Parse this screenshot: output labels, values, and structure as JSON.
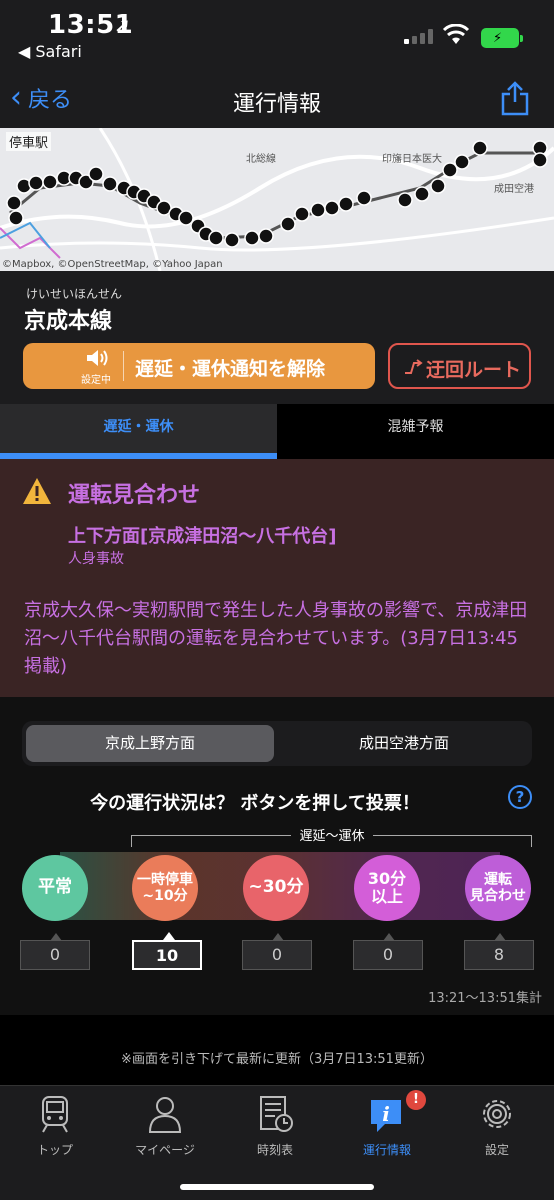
{
  "status_bar": {
    "time": "13:51",
    "back_app": "◀ Safari"
  },
  "nav": {
    "back_label": "戻る",
    "title": "運行情報"
  },
  "map": {
    "stop_label": "停車駅",
    "credit": "©Mapbox, ©OpenStreetMap, ©Yahoo Japan",
    "places": [
      "北総線",
      "印旛日本医大",
      "成田空港"
    ]
  },
  "line": {
    "reading": "けいせいほんせん",
    "name": "京成本線"
  },
  "actions": {
    "setting_status": "設定中",
    "notify_label": "遅延・運休通知を解除",
    "detour_label": "迂回ルート"
  },
  "tabs": {
    "delay": "遅延・運休",
    "congestion": "混雑予報"
  },
  "alert": {
    "headline": "運転見合わせ",
    "section": "上下方面[京成津田沼〜八千代台]",
    "cause": "人身事故",
    "body": "京成大久保〜実籾駅間で発生した人身事故の影響で、京成津田沼〜八千代台駅間の運転を見合わせています。(3月7日13:45 掲載)"
  },
  "direction": {
    "option1": "京成上野方面",
    "option2": "成田空港方面",
    "selected": "京成上野方面"
  },
  "vote": {
    "question": "今の運行状況は？ ボタンを押して投票！",
    "help": "?",
    "range_label": "遅延〜運休",
    "options": [
      {
        "line1": "平常",
        "line2": "",
        "count": "0",
        "color": "#5ec7a0"
      },
      {
        "line1": "一時停車",
        "line2": "~10分",
        "count": "10",
        "color": "#ea7c5a"
      },
      {
        "line1": "~30分",
        "line2": "",
        "count": "0",
        "color": "#e8646a"
      },
      {
        "line1": "30分",
        "line2": "以上",
        "count": "0",
        "color": "#d35ed8"
      },
      {
        "line1": "運転",
        "line2": "見合わせ",
        "count": "8",
        "color": "#be5ed8"
      }
    ],
    "aggregation": "13:21〜13:51集計"
  },
  "refresh_note": "※画面を引き下げて最新に更新（3月7日13:51更新）",
  "tabbar": {
    "items": [
      "トップ",
      "マイページ",
      "時刻表",
      "運行情報",
      "設定"
    ],
    "badge": "!"
  }
}
